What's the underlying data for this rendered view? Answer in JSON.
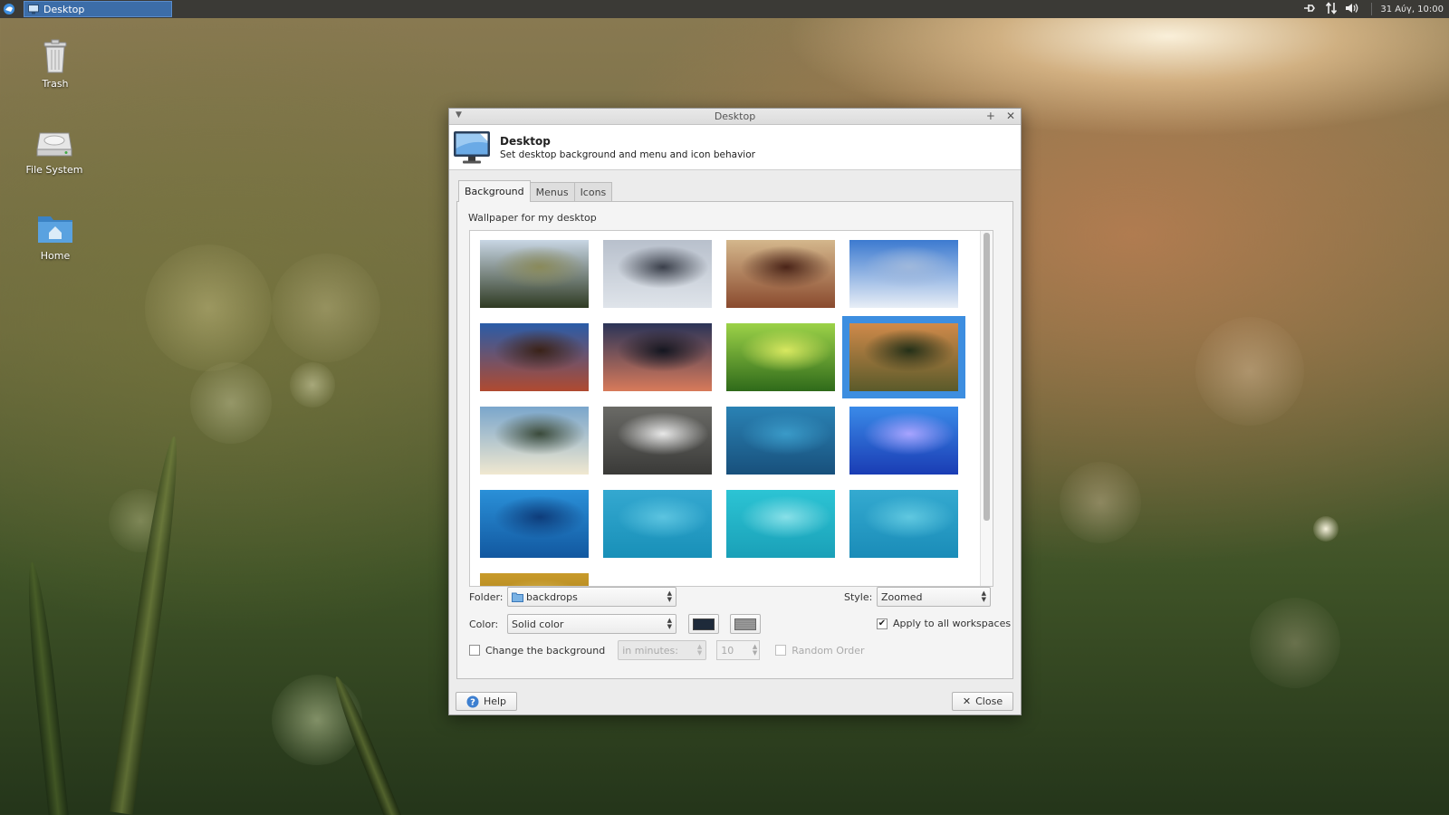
{
  "panel": {
    "taskbar_title": "Desktop",
    "clock": "31 Αύγ, 10:00",
    "icons": [
      "xfce-menu-icon",
      "network-icon",
      "transfer-icon",
      "volume-icon"
    ]
  },
  "desktop_icons": [
    {
      "label": "Trash",
      "icon": "trash-icon"
    },
    {
      "label": "File System",
      "icon": "drive-icon"
    },
    {
      "label": "Home",
      "icon": "home-folder-icon"
    }
  ],
  "dialog": {
    "window_title": "Desktop",
    "header_title": "Desktop",
    "header_subtitle": "Set desktop background and menu and icon behavior",
    "tabs": [
      {
        "label": "Background",
        "active": true
      },
      {
        "label": "Menus",
        "active": false
      },
      {
        "label": "Icons",
        "active": false
      }
    ],
    "wallpaper_section_label": "Wallpaper for my desktop",
    "thumbnails": [
      {
        "colors": [
          "#c8d6e4",
          "#2f3a22",
          "#8a8a5a"
        ],
        "selected": false
      },
      {
        "colors": [
          "#b8c0cc",
          "#dfe4ea",
          "#3a3f4a"
        ],
        "selected": false
      },
      {
        "colors": [
          "#d4b78c",
          "#8a4a2e",
          "#4a2418"
        ],
        "selected": false
      },
      {
        "colors": [
          "#3c7ad0",
          "#e8eef6",
          "#9fb8dc"
        ],
        "selected": false
      },
      {
        "colors": [
          "#2a5ca8",
          "#b04a30",
          "#3a2218"
        ],
        "selected": false
      },
      {
        "colors": [
          "#2b3458",
          "#d87a5a",
          "#141620"
        ],
        "selected": false
      },
      {
        "colors": [
          "#9cd248",
          "#2f6a1a",
          "#d8e860"
        ],
        "selected": false
      },
      {
        "colors": [
          "#d08a4a",
          "#5a5a2a",
          "#243018"
        ],
        "selected": true
      },
      {
        "colors": [
          "#7aa6cc",
          "#f0e8d0",
          "#3a4a3a"
        ],
        "selected": false
      },
      {
        "colors": [
          "#6a6a66",
          "#3a3a38",
          "#e8e8e8"
        ],
        "selected": false
      },
      {
        "colors": [
          "#2a82b4",
          "#18507c",
          "#3a9ac8"
        ],
        "selected": false
      },
      {
        "colors": [
          "#3a8ae8",
          "#1a3cb4",
          "#a8a4ff"
        ],
        "selected": false
      },
      {
        "colors": [
          "#2a90d8",
          "#1258a0",
          "#0e3c7a"
        ],
        "selected": false
      },
      {
        "colors": [
          "#34a8d0",
          "#1890b8",
          "#5cc4e0"
        ],
        "selected": false
      },
      {
        "colors": [
          "#2cc4d4",
          "#1aa0b8",
          "#88e0e8"
        ],
        "selected": false
      },
      {
        "colors": [
          "#34aad0",
          "#1a8cb8",
          "#60c8e0"
        ],
        "selected": false
      },
      {
        "colors": [
          "#c89a2a",
          "#8a6a14",
          "#e0c060"
        ],
        "selected": false
      }
    ],
    "folder_label": "Folder:",
    "folder_value": "backdrops",
    "style_label": "Style:",
    "style_value": "Zoomed",
    "color_label": "Color:",
    "color_value": "Solid color",
    "primary_color": "#1e2a3a",
    "secondary_color": "#8a8a8a",
    "apply_all_label": "Apply to all workspaces",
    "apply_all_checked": true,
    "change_bg_label": "Change the background",
    "change_bg_checked": false,
    "interval_unit": "in minutes:",
    "interval_value": "10",
    "random_order_label": "Random Order",
    "random_order_checked": false,
    "help_label": "Help",
    "close_label": "Close"
  }
}
